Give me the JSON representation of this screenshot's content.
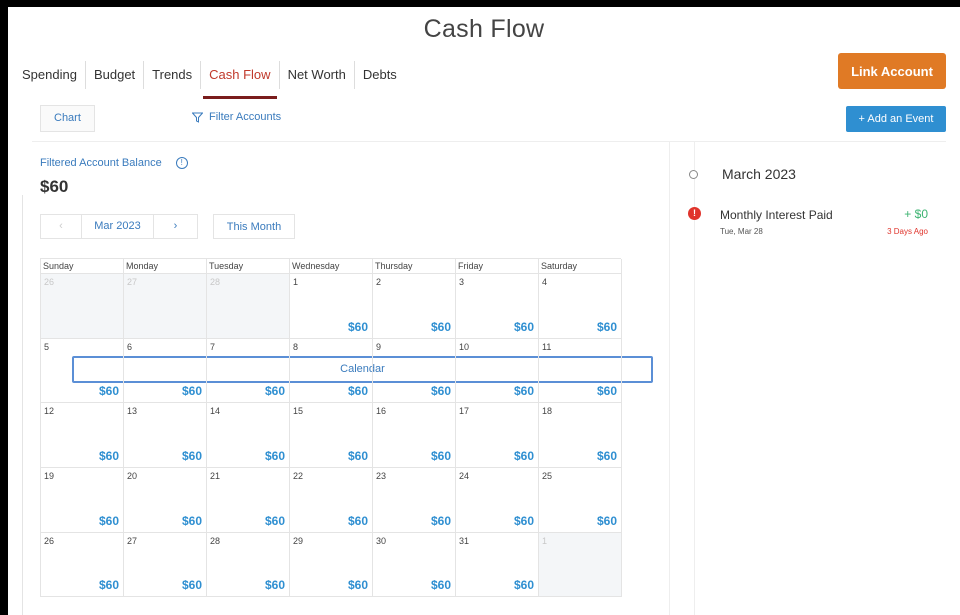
{
  "page_title": "Cash Flow",
  "nav": {
    "items": [
      {
        "label": "Spending",
        "active": false
      },
      {
        "label": "Budget",
        "active": false
      },
      {
        "label": "Trends",
        "active": false
      },
      {
        "label": "Cash Flow",
        "active": true
      },
      {
        "label": "Net Worth",
        "active": false
      },
      {
        "label": "Debts",
        "active": false
      }
    ],
    "link_account_label": "Link Account"
  },
  "toolbar": {
    "chart_label": "Chart",
    "calendar_label": "Calendar",
    "filter_label": "Filter Accounts",
    "add_event_label": "+ Add an Event"
  },
  "balance": {
    "label": "Filtered Account Balance",
    "value": "$60"
  },
  "month_nav": {
    "prev": "‹",
    "current": "Mar 2023",
    "next": "›",
    "this_month": "This Month"
  },
  "calendar": {
    "weekdays": [
      "Sunday",
      "Monday",
      "Tuesday",
      "Wednesday",
      "Thursday",
      "Friday",
      "Saturday"
    ],
    "weeks": [
      [
        {
          "day": "26",
          "out": true,
          "amount": ""
        },
        {
          "day": "27",
          "out": true,
          "amount": ""
        },
        {
          "day": "28",
          "out": true,
          "amount": ""
        },
        {
          "day": "1",
          "out": false,
          "amount": "$60"
        },
        {
          "day": "2",
          "out": false,
          "amount": "$60"
        },
        {
          "day": "3",
          "out": false,
          "amount": "$60"
        },
        {
          "day": "4",
          "out": false,
          "amount": "$60"
        }
      ],
      [
        {
          "day": "5",
          "out": false,
          "amount": "$60"
        },
        {
          "day": "6",
          "out": false,
          "amount": "$60"
        },
        {
          "day": "7",
          "out": false,
          "amount": "$60"
        },
        {
          "day": "8",
          "out": false,
          "amount": "$60"
        },
        {
          "day": "9",
          "out": false,
          "amount": "$60"
        },
        {
          "day": "10",
          "out": false,
          "amount": "$60"
        },
        {
          "day": "11",
          "out": false,
          "amount": "$60"
        }
      ],
      [
        {
          "day": "12",
          "out": false,
          "amount": "$60"
        },
        {
          "day": "13",
          "out": false,
          "amount": "$60"
        },
        {
          "day": "14",
          "out": false,
          "amount": "$60"
        },
        {
          "day": "15",
          "out": false,
          "amount": "$60"
        },
        {
          "day": "16",
          "out": false,
          "amount": "$60"
        },
        {
          "day": "17",
          "out": false,
          "amount": "$60"
        },
        {
          "day": "18",
          "out": false,
          "amount": "$60"
        }
      ],
      [
        {
          "day": "19",
          "out": false,
          "amount": "$60"
        },
        {
          "day": "20",
          "out": false,
          "amount": "$60"
        },
        {
          "day": "21",
          "out": false,
          "amount": "$60"
        },
        {
          "day": "22",
          "out": false,
          "amount": "$60"
        },
        {
          "day": "23",
          "out": false,
          "amount": "$60"
        },
        {
          "day": "24",
          "out": false,
          "amount": "$60"
        },
        {
          "day": "25",
          "out": false,
          "amount": "$60"
        }
      ],
      [
        {
          "day": "26",
          "out": false,
          "amount": "$60"
        },
        {
          "day": "27",
          "out": false,
          "amount": "$60"
        },
        {
          "day": "28",
          "out": false,
          "amount": "$60"
        },
        {
          "day": "29",
          "out": false,
          "amount": "$60"
        },
        {
          "day": "30",
          "out": false,
          "amount": "$60"
        },
        {
          "day": "31",
          "out": false,
          "amount": "$60"
        },
        {
          "day": "1",
          "out": true,
          "amount": ""
        }
      ]
    ]
  },
  "timeline": {
    "month": "March 2023",
    "events": [
      {
        "title": "Monthly Interest Paid",
        "date": "Tue, Mar 28",
        "amount": "+ $0",
        "ago": "3 Days Ago"
      }
    ]
  },
  "colors": {
    "accent_orange": "#e07a25",
    "accent_blue": "#2f8fd1",
    "active_tab": "#c0392b",
    "positive": "#3cb371",
    "alert": "#e0342c"
  }
}
